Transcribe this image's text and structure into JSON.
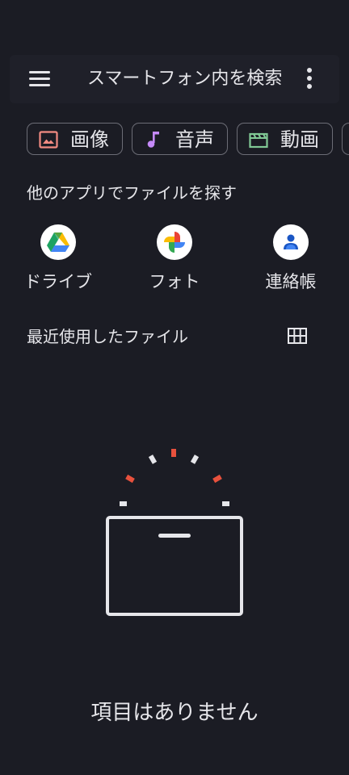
{
  "search": {
    "placeholder_text": "スマートフォン内を検索"
  },
  "chips": [
    {
      "label": "画像",
      "icon": "image-icon",
      "color": "#f28b82"
    },
    {
      "label": "音声",
      "icon": "music-note-icon",
      "color": "#c58af9"
    },
    {
      "label": "動画",
      "icon": "movie-icon",
      "color": "#81c995"
    }
  ],
  "other_apps": {
    "title": "他のアプリでファイルを探す",
    "apps": [
      {
        "label": "ドライブ",
        "icon": "google-drive-icon"
      },
      {
        "label": "フォト",
        "icon": "google-photos-icon"
      },
      {
        "label": "連絡帳",
        "icon": "contacts-icon"
      }
    ]
  },
  "recent": {
    "title": "最近使用したファイル",
    "view_toggle_icon": "grid-view-icon"
  },
  "empty_state": {
    "message": "項目はありません"
  },
  "colors": {
    "background": "#1b1c24",
    "text": "#e6e6ea",
    "accent_red": "#e8513d"
  }
}
